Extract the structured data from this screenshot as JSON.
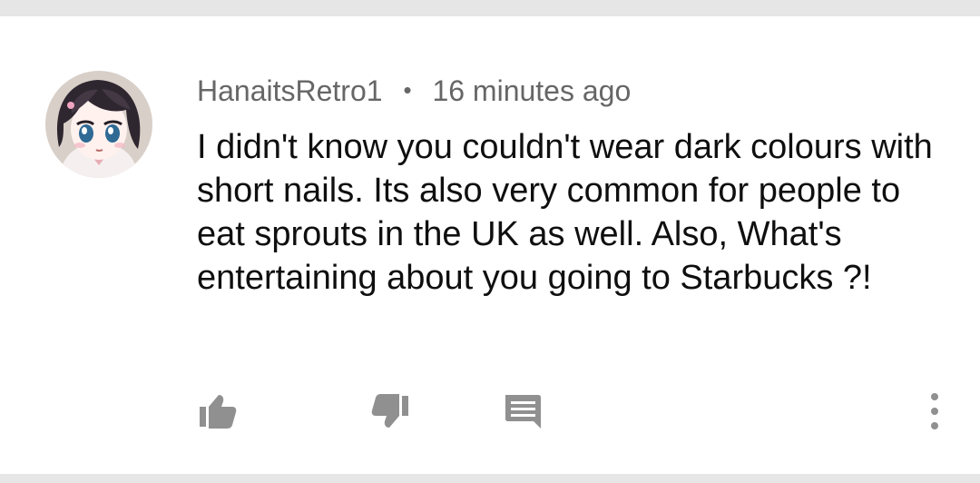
{
  "comment": {
    "author": "HanaitsRetro1",
    "separator": "•",
    "timestamp": "16 minutes ago",
    "text": "I didn't know you couldn't wear dark colours with short nails. Its also very common for people to eat sprouts in the UK as well. Also, What's entertaining about you going to Starbucks ?!"
  },
  "actions": {
    "like_icon": "thumbs-up-icon",
    "dislike_icon": "thumbs-down-icon",
    "reply_icon": "comment-icon",
    "more_icon": "more-vertical-icon"
  },
  "colors": {
    "background": "#ffffff",
    "divider": "#e6e6e6",
    "meta_text": "#666666",
    "body_text": "#0f0f0f",
    "icon": "#909090"
  }
}
